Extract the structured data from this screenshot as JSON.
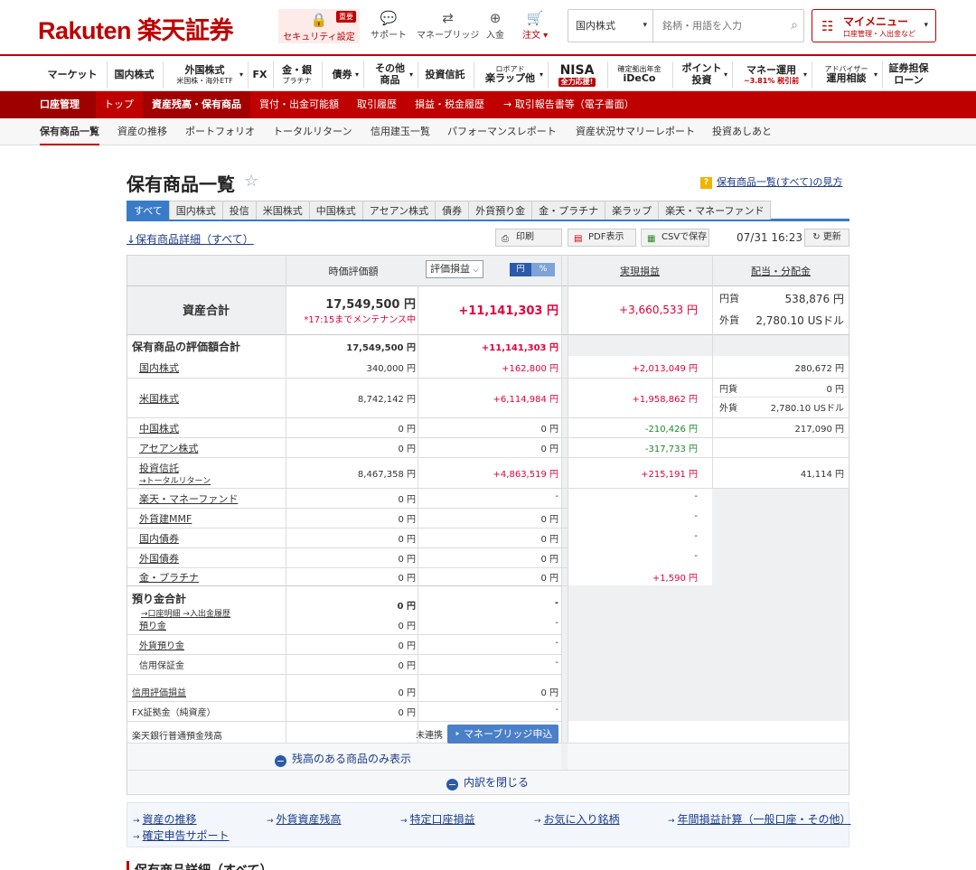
{
  "header": {
    "logo": "Rakuten 楽天証券",
    "security": {
      "label": "セキュリティ設定",
      "badge": "重要"
    },
    "support": "サポート",
    "moneybridge": "マネーブリッジ",
    "deposit": "入金",
    "order": "注文",
    "search_market": "国内株式",
    "search_placeholder": "銘柄・用語を入力",
    "mymenu_title": "マイメニュー",
    "mymenu_sub": "口座管理・入出金など"
  },
  "nav1": [
    {
      "label": "マーケット"
    },
    {
      "label": "国内株式"
    },
    {
      "label": "外国株式",
      "sub": "米国株・海外ETF"
    },
    {
      "label": "FX"
    },
    {
      "label": "金・銀",
      "sub": "プラチナ"
    },
    {
      "label": "債券"
    },
    {
      "label": "その他",
      "label2": "商品"
    },
    {
      "label": "投資信託"
    },
    {
      "label": "ロボアド",
      "label2": "楽ラップ他"
    },
    {
      "label": "NISA",
      "badge": "全力応援!"
    },
    {
      "label": "確定拠出年金",
      "label2": "iDeCo"
    },
    {
      "label": "ポイント",
      "label2": "投資"
    },
    {
      "label": "マネー運用",
      "red": "~3.81% 税引前"
    },
    {
      "label": "アドバイザー",
      "label2": "運用相談"
    },
    {
      "label": "証券担保",
      "label2": "ローン"
    }
  ],
  "nav2": {
    "account": "口座管理",
    "items": [
      "トップ",
      "資産残高・保有商品",
      "買付・出金可能額",
      "取引履歴",
      "損益・税金履歴",
      "→ 取引報告書等（電子書面）"
    ]
  },
  "nav3": [
    "保有商品一覧",
    "資産の推移",
    "ポートフォリオ",
    "トータルリターン",
    "信用建玉一覧",
    "パフォーマンスレポート",
    "資産状況サマリーレポート",
    "投資あしあと"
  ],
  "page": {
    "title": "保有商品一覧",
    "howto": "保有商品一覧(すべて)の見方",
    "tabs": [
      "すべて",
      "国内株式",
      "投信",
      "米国株式",
      "中国株式",
      "アセアン株式",
      "債券",
      "外貨預り金",
      "金・プラチナ",
      "楽ラップ",
      "楽天・マネーファンド"
    ],
    "detail_link": "↓保有商品詳細（すべて）",
    "print": "印刷",
    "pdf": "PDF表示",
    "csv": "CSVで保存",
    "timestamp": "07/31 16:23",
    "refresh": "更新"
  },
  "table": {
    "headers": {
      "valuation": "時価評価額",
      "pl_select": "評価損益",
      "unit_yen": "円",
      "unit_pct": "%",
      "realized": "実現損益",
      "dividend": "配当・分配金"
    },
    "total": {
      "label": "資産合計",
      "value": "17,549,500 円",
      "note": "*17:15までメンテナンス中",
      "pl": "+11,141,303 円",
      "realized": "+3,660,533 円",
      "div_yen_label": "円貨",
      "div_yen": "538,876 円",
      "div_fx_label": "外貨",
      "div_fx": "2,780.10 USドル"
    },
    "holdings_total": {
      "label": "保有商品の評価額合計",
      "value": "17,549,500 円",
      "pl": "+11,141,303 円"
    },
    "rows": [
      {
        "label": "国内株式",
        "value": "340,000 円",
        "pl": "+162,800 円",
        "realized": "+2,013,049 円",
        "div": "280,672 円"
      },
      {
        "label": "米国株式",
        "value": "8,742,142 円",
        "pl": "+6,114,984 円",
        "realized": "+1,958,862 円",
        "div_yen_label": "円貨",
        "div_yen": "0 円",
        "div_fx_label": "外貨",
        "div_fx": "2,780.10 USドル"
      },
      {
        "label": "中国株式",
        "value": "0 円",
        "pl": "0 円",
        "realized": "-210,426 円",
        "div": "217,090 円"
      },
      {
        "label": "アセアン株式",
        "value": "0 円",
        "pl": "0 円",
        "realized": "-317,733 円",
        "div": ""
      },
      {
        "label": "投資信託",
        "sublink": "→トータルリターン",
        "value": "8,467,358 円",
        "pl": "+4,863,519 円",
        "realized": "+215,191 円",
        "div": "41,114 円"
      },
      {
        "label": "楽天・マネーファンド",
        "value": "0 円",
        "pl": "-",
        "realized": "-",
        "div": ""
      },
      {
        "label": "外貨建MMF",
        "value": "0 円",
        "pl": "0 円",
        "realized": "-",
        "div": ""
      },
      {
        "label": "国内債券",
        "value": "0 円",
        "pl": "0 円",
        "realized": "-",
        "div": ""
      },
      {
        "label": "外国債券",
        "value": "0 円",
        "pl": "0 円",
        "realized": "-",
        "div": ""
      },
      {
        "label": "金・プラチナ",
        "value": "0 円",
        "pl": "0 円",
        "realized": "+1,590 円",
        "div": ""
      }
    ],
    "deposit_total": {
      "label": "預り金合計",
      "links": "→口座明細 →入出金履歴",
      "value": "0 円",
      "pl": "-"
    },
    "deposit_rows": [
      {
        "label": "預り金",
        "value": "0 円",
        "pl": "-"
      },
      {
        "label": "外貨預り金",
        "value": "0 円",
        "pl": "-"
      },
      {
        "label": "信用保証金",
        "value": "0 円",
        "pl": "-"
      }
    ],
    "other_rows": [
      {
        "label": "信用評価損益",
        "value": "0 円",
        "pl": "0 円"
      },
      {
        "label": "FX証拠金（純資産）",
        "value": "0 円",
        "pl": "-"
      }
    ],
    "bank": {
      "label": "楽天銀行普通預金残高",
      "status": "未連携",
      "button": "マネーブリッジ申込"
    },
    "show_only": "残高のある商品のみ表示",
    "close_detail": "内訳を閉じる"
  },
  "footer_links": [
    "資産の推移",
    "外貨資産残高",
    "特定口座損益",
    "お気に入り銘柄",
    "年間損益計算（一般口座・その他）",
    "確定申告サポート"
  ],
  "bottom_title": "保有商品詳細（すべて）"
}
